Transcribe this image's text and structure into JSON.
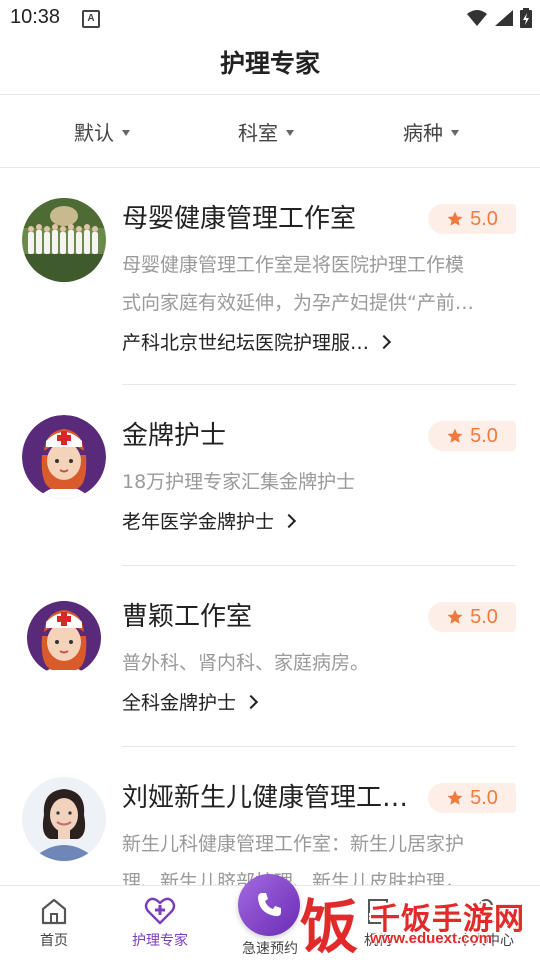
{
  "status": {
    "time": "10:38",
    "notif": "A"
  },
  "header": {
    "title": "护理专家"
  },
  "filters": [
    {
      "label": "默认"
    },
    {
      "label": "科室"
    },
    {
      "label": "病种"
    }
  ],
  "experts": [
    {
      "name": "母婴健康管理工作室",
      "rating": "5.0",
      "desc_line1": "母婴健康管理工作室是将医院护理工作模",
      "desc_line2": "式向家庭有效延伸，为孕产妇提供“产前…",
      "tag": "产科北京世纪坛医院护理服…"
    },
    {
      "name": "金牌护士",
      "rating": "5.0",
      "desc_line1": "18万护理专家汇集金牌护士",
      "tag": "老年医学金牌护士"
    },
    {
      "name": "曹颖工作室",
      "rating": "5.0",
      "desc_line1": "普外科、肾内科、家庭病房。",
      "tag": "全科金牌护士"
    },
    {
      "name": "刘娅新生儿健康管理工作…",
      "rating": "5.0",
      "desc_line1": "新生儿科健康管理工作室：新生儿居家护",
      "desc_line2": "理、新生儿脐部护理、新生儿皮肤护理，…"
    }
  ],
  "nav": {
    "home": "首页",
    "experts": "护理专家",
    "quick": "急速预约",
    "org": "机构",
    "me": "个人中心"
  },
  "watermark": {
    "char": "饭",
    "name": "千饭手游网",
    "url": "www.eduext.com"
  },
  "colors": {
    "accent": "#7a3dbd",
    "rating": "#f07a3e",
    "rating_bg": "#fdeee7"
  }
}
